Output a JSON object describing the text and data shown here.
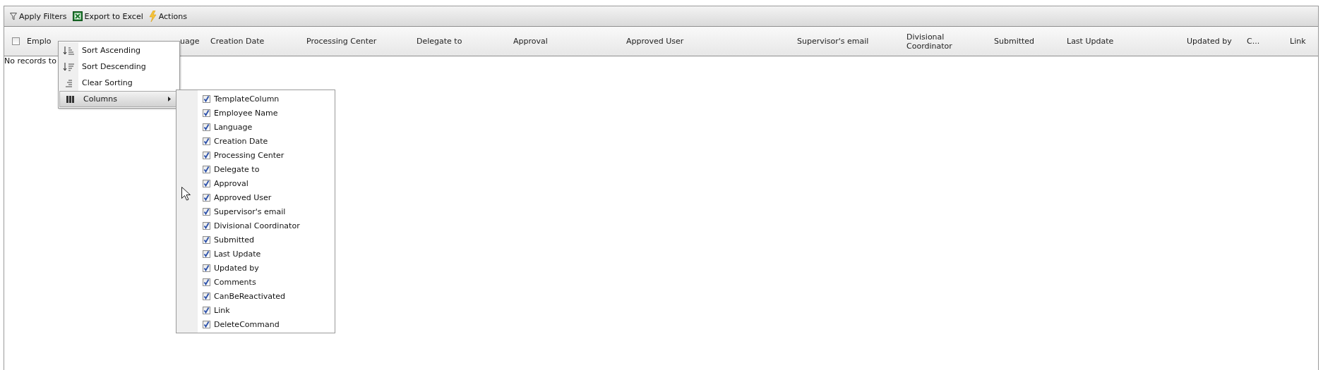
{
  "toolbar": [
    {
      "kind": "filter",
      "label": "Apply Filters"
    },
    {
      "kind": "excel",
      "label": "Export to Excel"
    },
    {
      "kind": "actions",
      "label": "Actions"
    }
  ],
  "header": {
    "select_all": {
      "checked": false
    },
    "columns": [
      "Emplo",
      "uage",
      "Creation Date",
      "Processing Center",
      "Delegate to",
      "Approval",
      "Approved User",
      "Supervisor's email",
      "Divisional Coordinator",
      "Submitted",
      "Last Update",
      "Updated by",
      "C...",
      "Link"
    ]
  },
  "message": "No records to",
  "context_menu": [
    {
      "kind": "sort-ascending",
      "label": "Sort Ascending",
      "selected": false
    },
    {
      "kind": "sort-descending",
      "label": "Sort Descending",
      "selected": false
    },
    {
      "kind": "clear-sorting",
      "label": "Clear Sorting",
      "selected": false
    },
    {
      "kind": "columns",
      "label": "Columns",
      "selected": true
    }
  ],
  "columns_menu": [
    {
      "label": "TemplateColumn",
      "checked": true
    },
    {
      "label": "Employee Name",
      "checked": true
    },
    {
      "label": "Language",
      "checked": true
    },
    {
      "label": "Creation Date",
      "checked": true
    },
    {
      "label": "Processing Center",
      "checked": true
    },
    {
      "label": "Delegate to",
      "checked": true
    },
    {
      "label": "Approval",
      "checked": true
    },
    {
      "label": "Approved User",
      "checked": true
    },
    {
      "label": "Supervisor's email",
      "checked": true
    },
    {
      "label": "Divisional Coordinator",
      "checked": true
    },
    {
      "label": "Submitted",
      "checked": true
    },
    {
      "label": "Last Update",
      "checked": true
    },
    {
      "label": "Updated by",
      "checked": true
    },
    {
      "label": "Comments",
      "checked": true
    },
    {
      "label": "CanBeReactivated",
      "checked": true
    },
    {
      "label": "Link",
      "checked": true
    },
    {
      "label": "DeleteCommand",
      "checked": true
    }
  ]
}
